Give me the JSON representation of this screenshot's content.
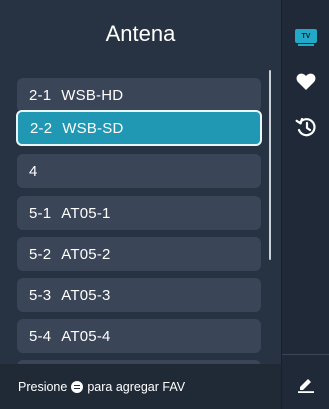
{
  "header": {
    "title": "Antena"
  },
  "channels": [
    {
      "number": "2-1",
      "name": "WSB-HD",
      "selected": false
    },
    {
      "number": "2-2",
      "name": "WSB-SD",
      "selected": true
    },
    {
      "number": "4",
      "name": "",
      "selected": false
    },
    {
      "number": "5-1",
      "name": "AT05-1",
      "selected": false
    },
    {
      "number": "5-2",
      "name": "AT05-2",
      "selected": false
    },
    {
      "number": "5-3",
      "name": "AT05-3",
      "selected": false
    },
    {
      "number": "5-4",
      "name": "AT05-4",
      "selected": false
    }
  ],
  "footer": {
    "prefix": "Presione",
    "suffix": "para agregar FAV"
  },
  "sidebar": {
    "tv_badge": "TV",
    "icons": [
      "tv-icon",
      "heart-icon",
      "history-icon",
      "edit-icon"
    ]
  },
  "colors": {
    "accent": "#2097b3",
    "tv_badge": "#22a9c7"
  }
}
